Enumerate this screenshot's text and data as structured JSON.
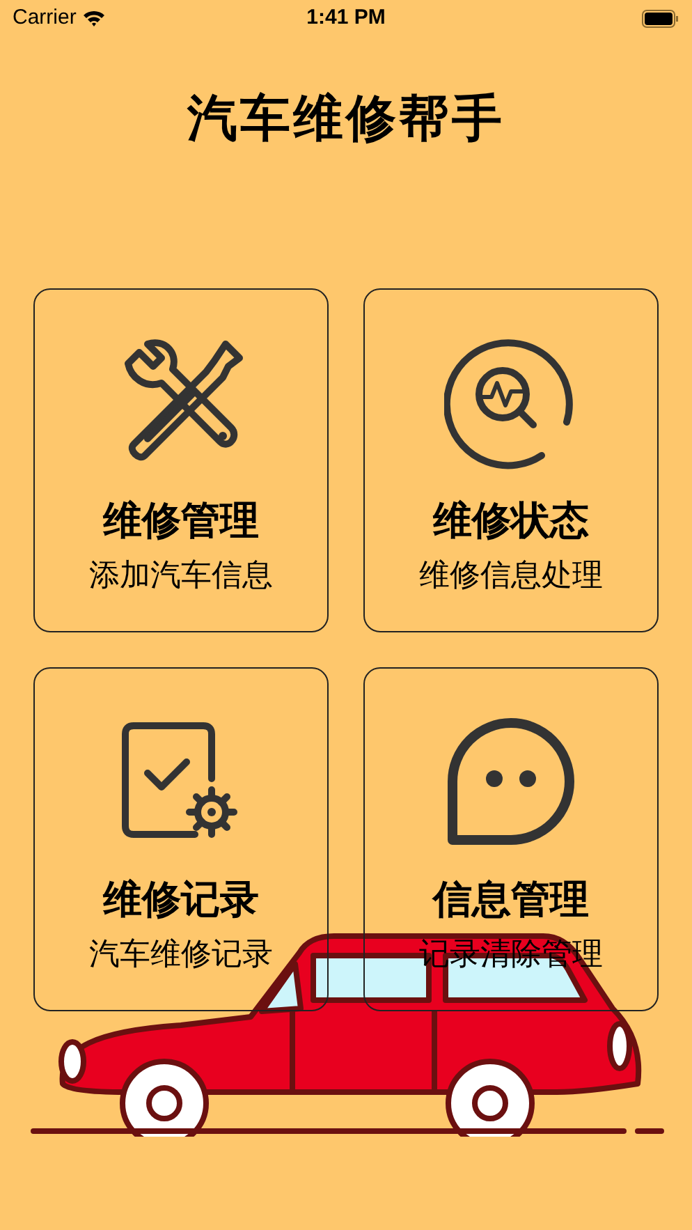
{
  "status_bar": {
    "carrier": "Carrier",
    "time": "1:41 PM"
  },
  "title": "汽车维修帮手",
  "cards": [
    {
      "kind": "tools",
      "title": "维修管理",
      "subtitle": "添加汽车信息"
    },
    {
      "kind": "diagnose",
      "title": "维修状态",
      "subtitle": "维修信息处理"
    },
    {
      "kind": "record",
      "title": "维修记录",
      "subtitle": "汽车维修记录"
    },
    {
      "kind": "chat",
      "title": "信息管理",
      "subtitle": "记录清除管理"
    }
  ]
}
